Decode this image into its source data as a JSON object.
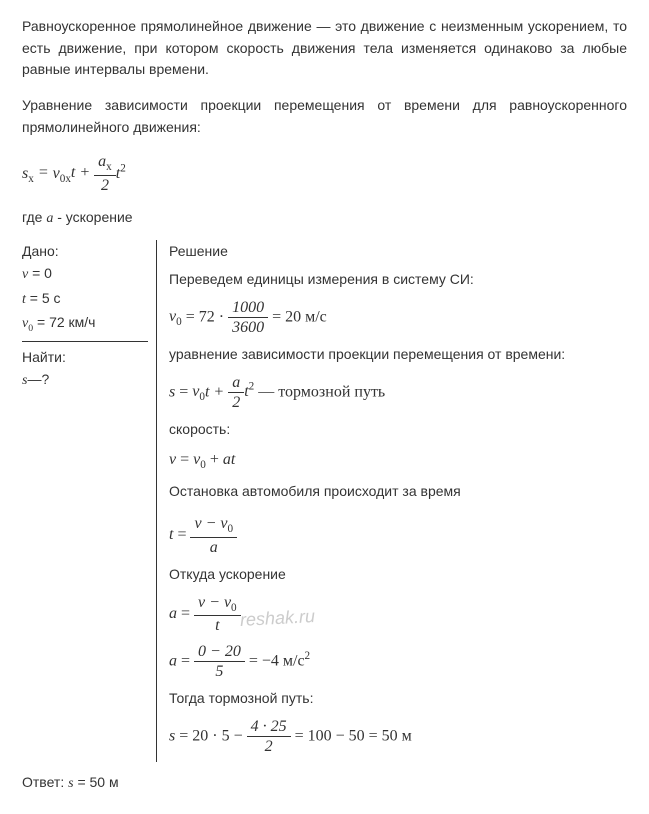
{
  "intro": {
    "p1": "Равноускоренное прямолинейное движение — это движение с неизменным ускорением, то есть движение, при котором скорость движения тела изменяется одинаково за любые равные интервалы времени.",
    "p2": "Уравнение зависимости проекции перемещения от времени для равноускоренного прямолинейного движения:",
    "note_prefix": "где ",
    "note_var": "a",
    "note_suffix": " - ускорение"
  },
  "formula_main": {
    "lhs": "s",
    "lhs_sub": "x",
    "eq": " = ",
    "v": "v",
    "v_sub": "0x",
    "t1": "t + ",
    "frac_num": "a",
    "frac_num_sub": "x",
    "frac_den": "2",
    "t2": "t",
    "t2_sup": "2"
  },
  "given": {
    "title": "Дано:",
    "l1_var": "v",
    "l1_val": " = 0",
    "l2_var": "t",
    "l2_val": " = 5 с",
    "l3_var": "v",
    "l3_sub": "0",
    "l3_val": " = 72 км/ч"
  },
  "find": {
    "title": "Найти:",
    "l1_var": "s",
    "l1_val": "—?"
  },
  "solution": {
    "title": "Решение",
    "convert_text": "Переведем единицы измерения в систему СИ:",
    "conv": {
      "v0": "v",
      "v0_sub": "0",
      "eq1": " = 72 · ",
      "frac_num": "1000",
      "frac_den": "3600",
      "eq2": " = 20 м/с"
    },
    "dep_text": "уравнение зависимости проекции перемещения от времени:",
    "s_eq": {
      "s": "s",
      "eq": " = ",
      "v": "v",
      "v_sub": "0",
      "t1": "t + ",
      "frac_num": "a",
      "frac_den": "2",
      "t2": "t",
      "t2_sup": "2",
      "tail": " — тормозной путь"
    },
    "speed_label": "скорость:",
    "v_eq": {
      "v": "v",
      "eq": " = ",
      "v0": "v",
      "v0_sub": "0",
      "plus": " + ",
      "a": "at"
    },
    "stop_text": "Остановка автомобиля происходит за время",
    "t_eq": {
      "t": "t",
      "eq": " = ",
      "num_a": "v",
      "num_minus": " − ",
      "num_b": "v",
      "num_b_sub": "0",
      "den": "a"
    },
    "accel_text": "Откуда ускорение",
    "a_eq1": {
      "a": "a",
      "eq": " = ",
      "num_a": "v",
      "num_minus": " − ",
      "num_b": "v",
      "num_b_sub": "0",
      "den": "t"
    },
    "a_eq2": {
      "a": "a",
      "eq": " = ",
      "num": "0 − 20",
      "den": "5",
      "tail": " = −4 м/с",
      "tail_sup": "2"
    },
    "then_text": "Тогда тормозной путь:",
    "s_final": {
      "s": "s",
      "eq": " = 20 · 5 − ",
      "num": "4 · 25",
      "den": "2",
      "tail": " = 100 − 50 = 50 м"
    }
  },
  "answer": {
    "label": "Ответ: ",
    "var": "s",
    "val": " = 50 м"
  },
  "watermark": "reshak.ru"
}
